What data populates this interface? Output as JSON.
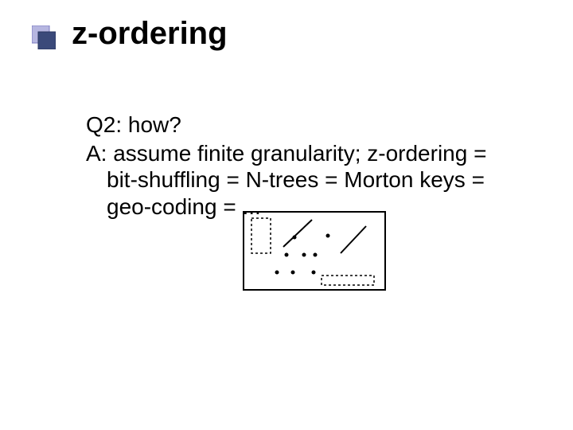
{
  "title": "z-ordering",
  "body": {
    "q2": "Q2: how?",
    "answer_line1": "A: assume finite granularity; z-ordering =",
    "answer_line2": "bit-shuffling = N-trees = Morton keys =",
    "answer_line3": "geo-coding = ..."
  }
}
